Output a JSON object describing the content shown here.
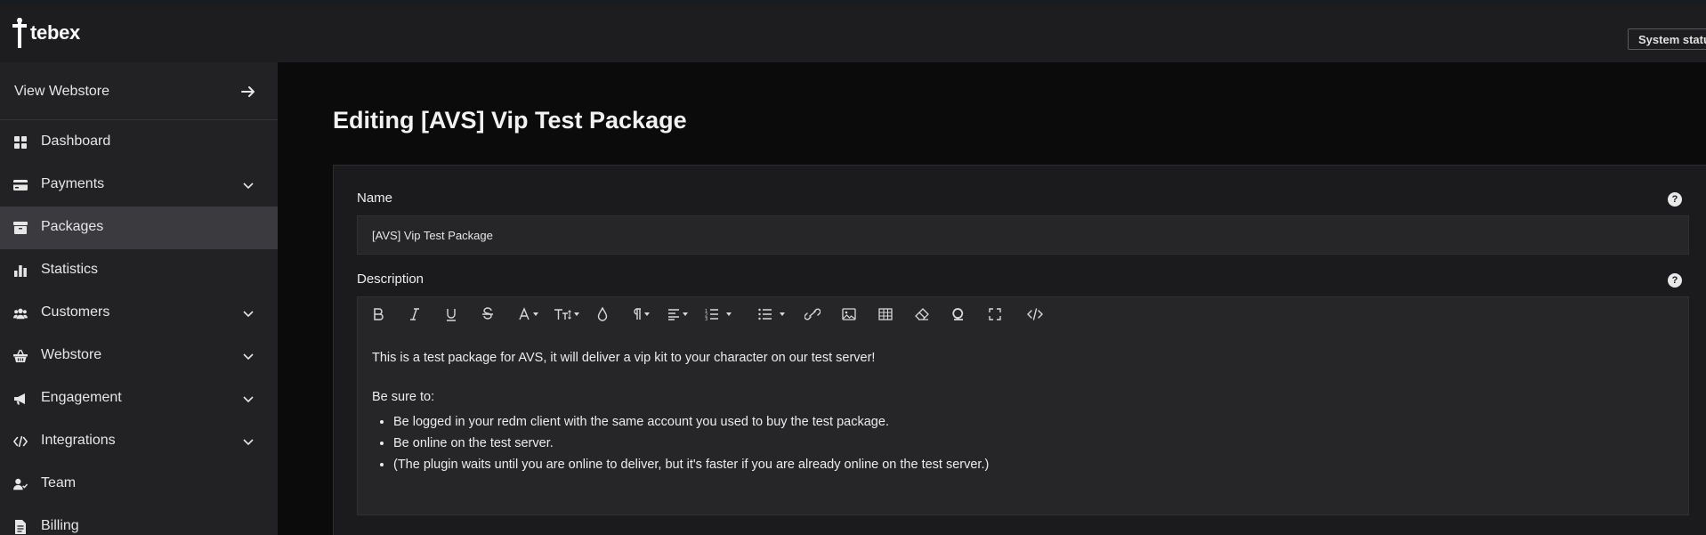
{
  "brand": {
    "logo_text": "tebex"
  },
  "topbar": {
    "system_status_label": "System status"
  },
  "sidebar": {
    "view_webstore": "View Webstore",
    "items": [
      {
        "label": "Dashboard",
        "icon": "grid-icon",
        "has_chevron": false,
        "active": false
      },
      {
        "label": "Payments",
        "icon": "card-icon",
        "has_chevron": true,
        "active": false
      },
      {
        "label": "Packages",
        "icon": "box-icon",
        "has_chevron": false,
        "active": true
      },
      {
        "label": "Statistics",
        "icon": "bar-chart-icon",
        "has_chevron": false,
        "active": false
      },
      {
        "label": "Customers",
        "icon": "users-icon",
        "has_chevron": true,
        "active": false
      },
      {
        "label": "Webstore",
        "icon": "basket-icon",
        "has_chevron": true,
        "active": false
      },
      {
        "label": "Engagement",
        "icon": "megaphone-icon",
        "has_chevron": true,
        "active": false
      },
      {
        "label": "Integrations",
        "icon": "code-icon",
        "has_chevron": true,
        "active": false
      },
      {
        "label": "Team",
        "icon": "user-check-icon",
        "has_chevron": false,
        "active": false
      },
      {
        "label": "Billing",
        "icon": "document-icon",
        "has_chevron": false,
        "active": false
      }
    ]
  },
  "main": {
    "page_title": "Editing [AVS] Vip Test Package",
    "name_field": {
      "label": "Name",
      "value": "[AVS] Vip Test Package"
    },
    "description_field": {
      "label": "Description",
      "paragraph1": "This is a test package for AVS, it will deliver a vip kit to your character on our test server!",
      "paragraph2": "Be sure to:",
      "bullets": [
        "Be logged in your redm client with the same account you used to buy the test package.",
        "Be online on the test server.",
        "(The plugin waits until you are online to deliver, but it's faster if you are already online on the test server.)"
      ]
    },
    "help_glyph": "?"
  },
  "colors": {
    "sidebar_bg": "#222225",
    "active_bg": "#3a3a3f",
    "card_bg": "#1b1b1d",
    "page_bg": "#0b0b0c"
  }
}
